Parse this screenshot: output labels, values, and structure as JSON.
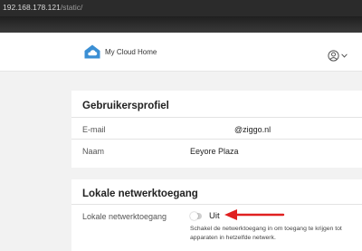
{
  "browser": {
    "url_host": "192.168.178.121",
    "url_path": "/static/"
  },
  "header": {
    "app_title": "My Cloud Home",
    "logo_icon": "cloud-home-icon",
    "user_icon": "user-circle-icon",
    "menu_icon": "chevron-down-icon"
  },
  "profile": {
    "title": "Gebruikersprofiel",
    "email_label": "E-mail",
    "email_value": "@ziggo.nl",
    "name_label": "Naam",
    "name_value": "Eeyore Plaza"
  },
  "local_access": {
    "title": "Lokale netwerktoegang",
    "toggle_label": "Lokale netwerktoegang",
    "toggle_state": "Uit",
    "toggle_on": false,
    "help_text": "Schakel de netwerktoegang in om toegang te krijgen tot apparaten in hetzelfde netwerk."
  },
  "annotation": {
    "arrow_color": "#e02020",
    "arrow_icon": "arrow-left-icon"
  },
  "colors": {
    "brand_blue": "#3b8fd4",
    "page_bg": "#f2f2f2"
  }
}
